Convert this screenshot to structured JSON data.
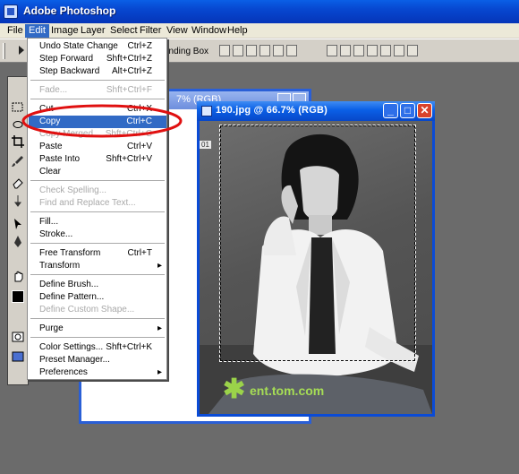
{
  "app": {
    "title": "Adobe Photoshop"
  },
  "menubar": [
    "File",
    "Edit",
    "Image",
    "Layer",
    "Select",
    "Filter",
    "View",
    "Window",
    "Help"
  ],
  "options_bar": {
    "partial_label": "unding Box"
  },
  "edit_menu": {
    "items": [
      {
        "label": "Undo State Change",
        "shortcut": "Ctrl+Z",
        "enabled": true
      },
      {
        "label": "Step Forward",
        "shortcut": "Shft+Ctrl+Z",
        "enabled": true
      },
      {
        "label": "Step Backward",
        "shortcut": "Alt+Ctrl+Z",
        "enabled": true
      },
      {
        "label": "Fade...",
        "shortcut": "Shft+Ctrl+F",
        "enabled": false
      },
      {
        "label": "Cut",
        "shortcut": "Ctrl+X",
        "enabled": true
      },
      {
        "label": "Copy",
        "shortcut": "Ctrl+C",
        "enabled": true,
        "highlighted": true
      },
      {
        "label": "Copy Merged",
        "shortcut": "Shft+Ctrl+C",
        "enabled": false
      },
      {
        "label": "Paste",
        "shortcut": "Ctrl+V",
        "enabled": true
      },
      {
        "label": "Paste Into",
        "shortcut": "Shft+Ctrl+V",
        "enabled": true
      },
      {
        "label": "Clear",
        "shortcut": "",
        "enabled": true
      },
      {
        "label": "Check Spelling...",
        "shortcut": "",
        "enabled": false
      },
      {
        "label": "Find and Replace Text...",
        "shortcut": "",
        "enabled": false
      },
      {
        "label": "Fill...",
        "shortcut": "",
        "enabled": true
      },
      {
        "label": "Stroke...",
        "shortcut": "",
        "enabled": true
      },
      {
        "label": "Free Transform",
        "shortcut": "Ctrl+T",
        "enabled": true
      },
      {
        "label": "Transform",
        "shortcut": "",
        "enabled": true,
        "submenu": true
      },
      {
        "label": "Define Brush...",
        "shortcut": "",
        "enabled": true
      },
      {
        "label": "Define Pattern...",
        "shortcut": "",
        "enabled": true
      },
      {
        "label": "Define Custom Shape...",
        "shortcut": "",
        "enabled": false
      },
      {
        "label": "Purge",
        "shortcut": "",
        "enabled": true,
        "submenu": true
      },
      {
        "label": "Color Settings...",
        "shortcut": "Shft+Ctrl+K",
        "enabled": true
      },
      {
        "label": "Preset Manager...",
        "shortcut": "",
        "enabled": true
      },
      {
        "label": "Preferences",
        "shortcut": "",
        "enabled": true,
        "submenu": true
      }
    ]
  },
  "documents": {
    "background": {
      "title_partial": "7% (RGB)"
    },
    "active": {
      "title": "190.jpg @ 66.7% (RGB)",
      "ruler_corner": "01"
    },
    "watermark": "ent.tom.com"
  },
  "colors": {
    "title_blue": "#0a5fe6",
    "menu_highlight": "#316ac5",
    "annotation_red": "#e01010",
    "watermark_green": "#a6dd55"
  },
  "icons": [
    "app-icon",
    "move-tool-icon",
    "marquee-tool-icon",
    "lasso-tool-icon",
    "crop-tool-icon",
    "brush-tool-icon",
    "eraser-tool-icon",
    "pen-tool-icon",
    "type-tool-icon",
    "hand-tool-icon",
    "zoom-tool-icon",
    "minimize-icon",
    "maximize-icon",
    "close-icon",
    "submenu-arrow-icon"
  ]
}
